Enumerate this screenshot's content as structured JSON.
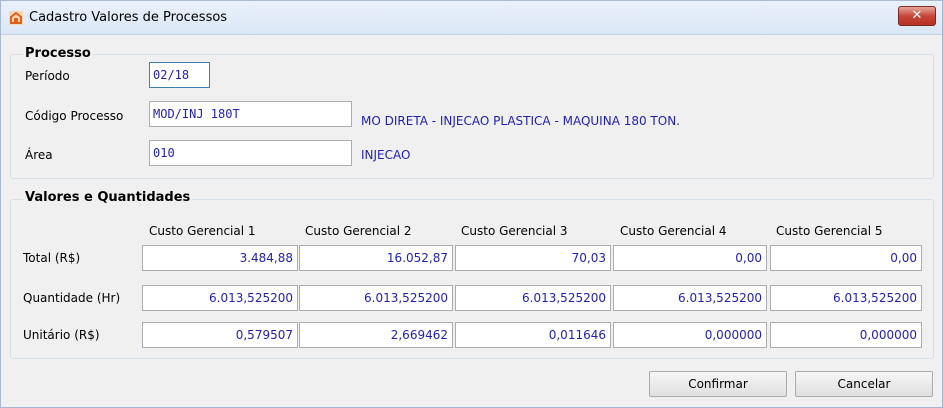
{
  "window": {
    "title": "Cadastro Valores de Processos",
    "close_glyph": "✕"
  },
  "processo": {
    "title": "Processo",
    "periodo_label": "Período",
    "periodo_value": "02/18",
    "codigo_label": "Código Processo",
    "codigo_value": "MOD/INJ 180T",
    "codigo_desc": "MO DIRETA - INJECAO PLASTICA - MAQUINA 180 TON.",
    "area_label": "Área",
    "area_value": "010",
    "area_desc": "INJECAO"
  },
  "valores": {
    "title": "Valores e Quantidades",
    "columns": [
      "Custo Gerencial 1",
      "Custo Gerencial 2",
      "Custo Gerencial 3",
      "Custo Gerencial 4",
      "Custo Gerencial 5"
    ],
    "rows": [
      {
        "label": "Total  (R$)",
        "values": [
          "3.484,88",
          "16.052,87",
          "70,03",
          "0,00",
          "0,00"
        ]
      },
      {
        "label": "Quantidade  (Hr)",
        "values": [
          "6.013,525200",
          "6.013,525200",
          "6.013,525200",
          "6.013,525200",
          "6.013,525200"
        ]
      },
      {
        "label": "Unitário  (R$)",
        "values": [
          "0,579507",
          "2,669462",
          "0,011646",
          "0,000000",
          "0,000000"
        ]
      }
    ]
  },
  "buttons": {
    "confirm": "Confirmar",
    "cancel": "Cancelar"
  }
}
